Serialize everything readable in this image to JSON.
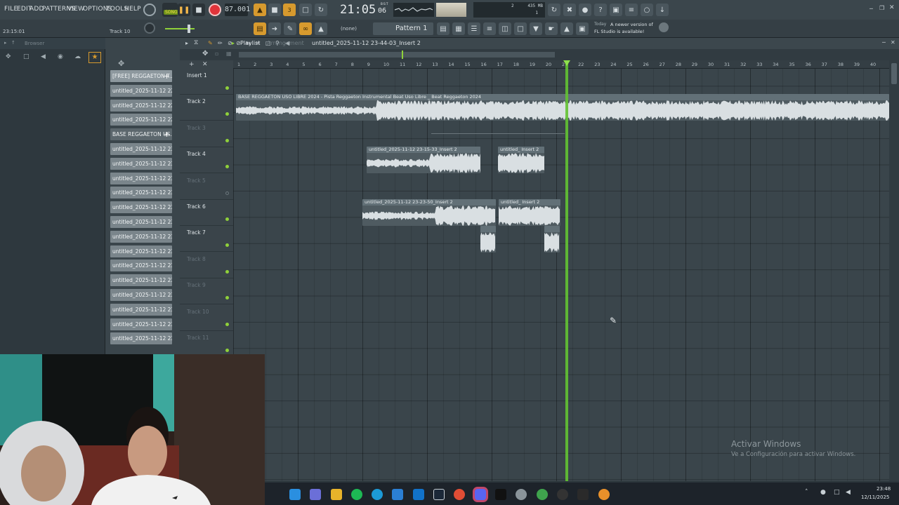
{
  "menu": [
    "FILE",
    "EDIT",
    "ADD",
    "PATTERNS",
    "VIEW",
    "OPTIONS",
    "TOOLS",
    "HELP"
  ],
  "transport": {
    "mode": "SONG",
    "tempo": "87.001",
    "time": "21:05",
    "time_sub": "06",
    "time_sup": "B:S:T"
  },
  "status": {
    "clock": "23:15:01",
    "current_track": "Track 10"
  },
  "meter": {
    "memory": "435 MB",
    "cpu_label": "2",
    "polyphony": "1"
  },
  "pattern": {
    "none_label": "(none)",
    "name": "Pattern 1"
  },
  "news": {
    "day": "Today",
    "line1": "A newer version of",
    "line2": "FL Studio is available!"
  },
  "browser": {
    "label": "Browser"
  },
  "playlist": {
    "title": "Playlist",
    "subtitle": "Arrangement",
    "path": "untitled_2025-11-12 23-44-03_Insert 2"
  },
  "clip_list": [
    "[FREE] REGGAETON T...",
    "untitled_2025-11-12 22-...",
    "untitled_2025-11-12 22-...",
    "untitled_2025-11-12 22-...",
    "BASE REGGAETON US...",
    "untitled_2025-11-12 23-...",
    "untitled_2025-11-12 23-...",
    "untitled_2025-11-12 23-...",
    "untitled_2025-11-12 23-...",
    "untitled_2025-11-12 23-...",
    "untitled_2025-11-12 23-...",
    "untitled_2025-11-12 23-...",
    "untitled_2025-11-12 23-...",
    "untitled_2025-11-12 23-...",
    "untitled_2025-11-12 23-...",
    "untitled_2025-11-12 23-...",
    "untitled_2025-11-12 23-...",
    "untitled_2025-11-12 23-...",
    "untitled_2025-11-12 23-..."
  ],
  "tracks": [
    "Insert 1",
    "Track 2",
    "Track 3",
    "Track 4",
    "Track 5",
    "Track 6",
    "Track 7",
    "Track 8",
    "Track 9",
    "Track 10",
    "Track 11"
  ],
  "ruler": [
    "1",
    "2",
    "3",
    "4",
    "5",
    "6",
    "7",
    "8",
    "9",
    "10",
    "11",
    "12",
    "13",
    "14",
    "15",
    "16",
    "17",
    "18",
    "19",
    "20",
    "21",
    "22",
    "23",
    "24",
    "25",
    "26",
    "27",
    "28",
    "29",
    "30",
    "31",
    "32",
    "33",
    "34",
    "35",
    "36",
    "37",
    "38",
    "39",
    "40"
  ],
  "clips": {
    "beat": "BASE REGGAETON USO LIBRE 2024 - Pista Reggaeton Instrumental Beat Uso Libre _ Beat Reggaeton 2024",
    "t4a": "untitled_2025-11-12 23-15-33_Insert 2",
    "t4b": "untitled_ Insert 2",
    "t6a": "untitled_2025-11-12 23-23-50_Insert 2",
    "t6b": "untitled_ Insert 2"
  },
  "watermark": {
    "title": "Activar Windows",
    "sub": "Ve a Configuración para activar Windows."
  },
  "clock": {
    "time": "23:48",
    "date": "12/11/2025"
  },
  "colors": {
    "accent": "#d79a2e",
    "playhead": "#63c233",
    "record": "#e0343a"
  }
}
